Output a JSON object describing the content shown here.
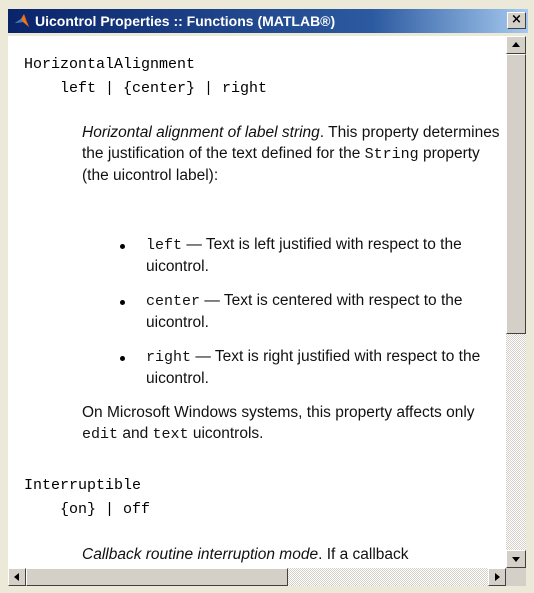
{
  "window": {
    "title": "Uicontrol Properties :: Functions (MATLAB®)",
    "close_label": "×"
  },
  "properties": [
    {
      "name": "HorizontalAlignment",
      "values": "left | {center} | right",
      "summary_italic": "Horizontal alignment of label string",
      "summary_rest": ". This property determines the justification of the text defined for the ",
      "summary_code": "String",
      "summary_end": " property (the uicontrol label):",
      "bullets": [
        {
          "code": "left",
          "text": " — Text is left justified with respect to the uicontrol."
        },
        {
          "code": "center",
          "text": " — Text is centered with respect to the uicontrol."
        },
        {
          "code": "right",
          "text": " — Text is right justified with respect to the uicontrol."
        }
      ],
      "note_pre": "On Microsoft Windows systems, this property affects only ",
      "note_code1": "edit",
      "note_mid": " and ",
      "note_code2": "text",
      "note_end": " uicontrols."
    },
    {
      "name": "Interruptible",
      "values": "{on} | off",
      "summary_italic": "Callback routine interruption mode",
      "summary_rest": ". If a callback"
    }
  ],
  "colors": {
    "titlebar_start": "#0a246a",
    "titlebar_end": "#a6caf0",
    "window_face": "#d4d0c8",
    "content_bg": "#ffffff"
  },
  "icons": {
    "title": "matlab-logo-icon",
    "close": "close-icon",
    "scroll_up": "arrow-up-icon",
    "scroll_down": "arrow-down-icon",
    "scroll_left": "arrow-left-icon",
    "scroll_right": "arrow-right-icon"
  }
}
